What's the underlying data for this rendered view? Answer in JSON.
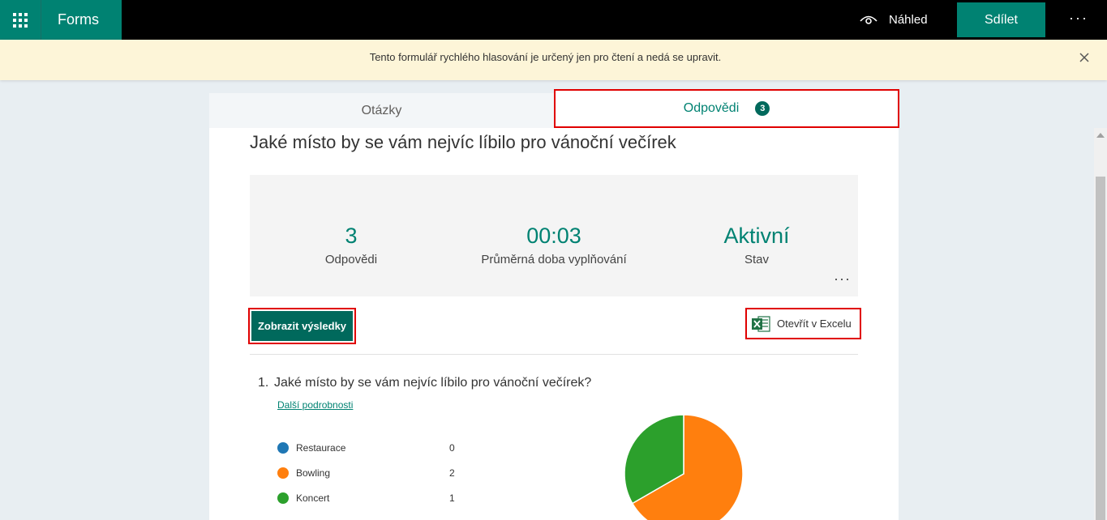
{
  "topbar": {
    "app_name": "Forms",
    "preview_label": "Náhled",
    "share_label": "Sdílet",
    "more_label": "···"
  },
  "notice": {
    "text": "Tento formulář rychlého hlasování je určený jen pro čtení a nedá se upravit."
  },
  "tabs": {
    "questions": "Otázky",
    "responses": "Odpovědi",
    "responses_count": "3"
  },
  "form": {
    "title": "Jaké místo by se vám nejvíc líbilo pro vánoční večírek"
  },
  "stats": {
    "responses_value": "3",
    "responses_label": "Odpovědi",
    "avg_time_value": "00:03",
    "avg_time_label": "Průměrná doba vyplňování",
    "status_value": "Aktivní",
    "status_label": "Stav",
    "more_label": "···"
  },
  "actions": {
    "view_results": "Zobrazit výsledky",
    "open_excel": "Otevřít v Excelu"
  },
  "question": {
    "number": "1.",
    "text": "Jaké místo by se vám nejvíc líbilo pro vánoční večírek?",
    "details_link": "Další podrobnosti"
  },
  "colors": {
    "accent": "#008272",
    "restaurace": "#1f77b4",
    "bowling": "#ff7f0e",
    "koncert": "#2ca02c"
  },
  "chart_data": {
    "type": "pie",
    "categories": [
      "Restaurace",
      "Bowling",
      "Koncert"
    ],
    "values": [
      0,
      2,
      1
    ],
    "colors": [
      "#1f77b4",
      "#ff7f0e",
      "#2ca02c"
    ]
  }
}
